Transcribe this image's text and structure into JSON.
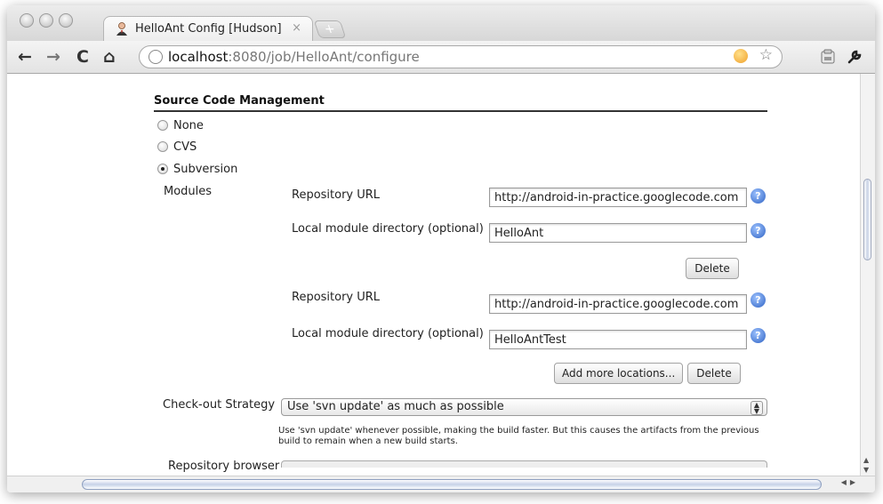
{
  "browser": {
    "tab_title": "HelloAnt Config [Hudson]",
    "tab_close": "×",
    "new_tab": "+",
    "url_host": "localhost",
    "url_rest": ":8080/job/HelloAnt/configure",
    "nav": {
      "back": "←",
      "forward": "→",
      "reload": "C",
      "home": "⌂"
    },
    "star": "☆",
    "wrench": "🔧"
  },
  "scm": {
    "section_title": "Source Code Management",
    "options": [
      {
        "label": "None",
        "selected": false
      },
      {
        "label": "CVS",
        "selected": false
      },
      {
        "label": "Subversion",
        "selected": true
      }
    ],
    "modules_label": "Modules",
    "repository_url_label": "Repository URL",
    "local_dir_label": "Local module directory (optional)",
    "modules": [
      {
        "repository_url": "http://android-in-practice.googlecode.com",
        "local_dir": "HelloAnt"
      },
      {
        "repository_url": "http://android-in-practice.googlecode.com",
        "local_dir": "HelloAntTest"
      }
    ],
    "delete_label": "Delete",
    "add_more_label": "Add more locations...",
    "help_glyph": "?",
    "checkout_strategy_label": "Check-out Strategy",
    "checkout_strategy_value": "Use 'svn update' as much as possible",
    "checkout_description": "Use 'svn update' whenever possible, making the build faster. But this causes the artifacts from the previous build to remain when a new build starts.",
    "next_label_partial": "Repository browser"
  }
}
